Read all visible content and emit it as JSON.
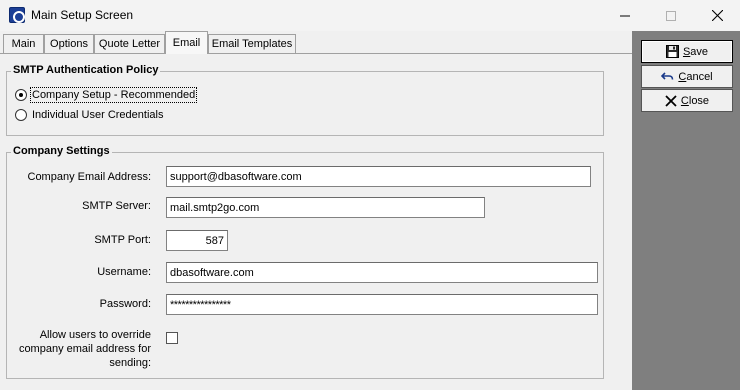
{
  "window": {
    "title": "Main Setup Screen",
    "controls": {
      "minimize_icon": "minimize-icon",
      "maximize_icon": "maximize-icon",
      "close_icon": "close-icon"
    }
  },
  "tabs": [
    {
      "label": "Main"
    },
    {
      "label": "Options"
    },
    {
      "label": "Quote Letter"
    },
    {
      "label": "Email",
      "active": true
    },
    {
      "label": "Email Templates"
    }
  ],
  "smtp_policy": {
    "legend": "SMTP Authentication Policy",
    "options": [
      {
        "label": "Company Setup - Recommended",
        "checked": true
      },
      {
        "label": "Individual User Credentials",
        "checked": false
      }
    ]
  },
  "company_settings": {
    "legend": "Company Settings",
    "email_label": "Company Email Address:",
    "email_value": "support@dbasoftware.com",
    "smtp_server_label": "SMTP Server:",
    "smtp_server_value": "mail.smtp2go.com",
    "smtp_port_label": "SMTP Port:",
    "smtp_port_value": "587",
    "username_label": "Username:",
    "username_value": "dbasoftware.com",
    "password_label": "Password:",
    "password_value": "****************",
    "override_label_line1": "Allow users to override",
    "override_label_line2": "company email address for",
    "override_label_line3": "sending:",
    "override_checked": false
  },
  "actions": {
    "save_accel": "S",
    "save_rest": "ave",
    "cancel_accel": "C",
    "cancel_rest": "ancel",
    "close_accel": "C",
    "close_rest": "lose",
    "save_icon": "floppy-disk-icon",
    "cancel_icon": "undo-arrow-icon",
    "close_icon": "x-icon"
  },
  "colors": {
    "right_panel": "#7f7f7f",
    "form_background": "#f0f0f0",
    "app_icon": "#1c3f96"
  }
}
